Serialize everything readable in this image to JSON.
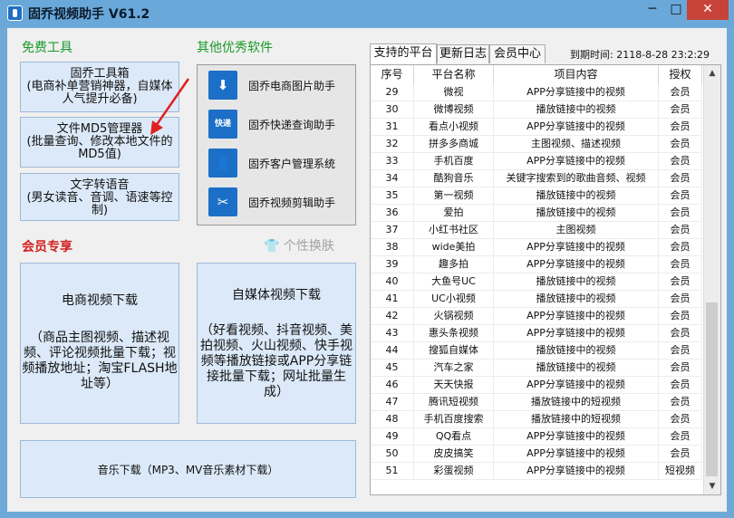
{
  "window": {
    "title": "固乔视频助手 V61.2",
    "controls": {
      "minimize": "─",
      "maximize": "□",
      "close": "✕"
    }
  },
  "free_tools": {
    "title": "免费工具",
    "buttons": [
      {
        "title": "固乔工具箱",
        "desc": "(电商补单营销神器，自媒体人气提升必备)"
      },
      {
        "title": "文件MD5管理器",
        "desc": "(批量查询、修改本地文件的MD5值)"
      },
      {
        "title": "文字转语音",
        "desc": "(男女读音、音调、语速等控制)"
      }
    ]
  },
  "other_software": {
    "title": "其他优秀软件",
    "items": [
      {
        "label": "固乔电商图片助手",
        "icon": "download-icon"
      },
      {
        "label": "固乔快递查询助手",
        "icon": "express-icon"
      },
      {
        "label": "固乔客户管理系统",
        "icon": "person-icon"
      },
      {
        "label": "固乔视频剪辑助手",
        "icon": "scissors-icon"
      }
    ]
  },
  "member": {
    "title": "会员专享",
    "skin_label": "个性换肤",
    "ecommerce": {
      "title": "电商视频下载",
      "desc": "（商品主图视频、描述视频、评论视频批量下载；视频播放地址；淘宝FLASH地址等）"
    },
    "selfmedia": {
      "title": "自媒体视频下载",
      "desc": "（好看视频、抖音视频、美拍视频、火山视频、快手视频等播放链接或APP分享链接批量下载；网址批量生成）"
    },
    "music": {
      "title": "音乐下载（MP3、MV音乐素材下载）"
    }
  },
  "platforms": {
    "tabs": [
      "支持的平台",
      "更新日志",
      "会员中心"
    ],
    "active_tab": 0,
    "expire_label": "到期时间: 2118-8-28 23:2:29",
    "columns": [
      "序号",
      "平台名称",
      "项目内容",
      "授权"
    ],
    "rows": [
      [
        "29",
        "微视",
        "APP分享链接中的视频",
        "会员"
      ],
      [
        "30",
        "微博视频",
        "播放链接中的视频",
        "会员"
      ],
      [
        "31",
        "看点小视频",
        "APP分享链接中的视频",
        "会员"
      ],
      [
        "32",
        "拼多多商城",
        "主图视频、描述视频",
        "会员"
      ],
      [
        "33",
        "手机百度",
        "APP分享链接中的视频",
        "会员"
      ],
      [
        "34",
        "酷狗音乐",
        "关键字搜索到的歌曲音频、视频",
        "会员"
      ],
      [
        "35",
        "第一视频",
        "播放链接中的视频",
        "会员"
      ],
      [
        "36",
        "爱拍",
        "播放链接中的视频",
        "会员"
      ],
      [
        "37",
        "小红书社区",
        "主图视频",
        "会员"
      ],
      [
        "38",
        "wide美拍",
        "APP分享链接中的视频",
        "会员"
      ],
      [
        "39",
        "趣多拍",
        "APP分享链接中的视频",
        "会员"
      ],
      [
        "40",
        "大鱼号UC",
        "播放链接中的视频",
        "会员"
      ],
      [
        "41",
        "UC小视频",
        "播放链接中的视频",
        "会员"
      ],
      [
        "42",
        "火锅视频",
        "APP分享链接中的视频",
        "会员"
      ],
      [
        "43",
        "惠头条视频",
        "APP分享链接中的视频",
        "会员"
      ],
      [
        "44",
        "搜狐自媒体",
        "播放链接中的视频",
        "会员"
      ],
      [
        "45",
        "汽车之家",
        "播放链接中的视频",
        "会员"
      ],
      [
        "46",
        "天天快报",
        "APP分享链接中的视频",
        "会员"
      ],
      [
        "47",
        "腾讯短视频",
        "播放链接中的短视频",
        "会员"
      ],
      [
        "48",
        "手机百度搜索",
        "播放链接中的短视频",
        "会员"
      ],
      [
        "49",
        "QQ看点",
        "APP分享链接中的视频",
        "会员"
      ],
      [
        "50",
        "皮皮搞笑",
        "APP分享链接中的视频",
        "会员"
      ],
      [
        "51",
        "彩蛋视频",
        "APP分享链接中的视频",
        "短视频"
      ]
    ]
  }
}
